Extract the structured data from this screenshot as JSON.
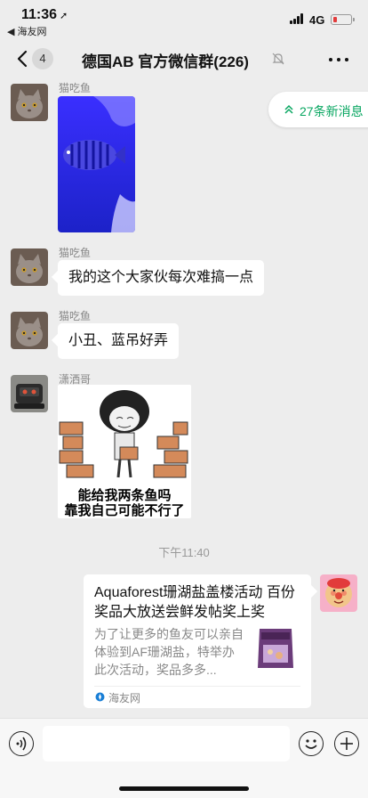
{
  "status_bar": {
    "time": "11:36",
    "location_arrow": "➚",
    "back_app": "◀ 海友网",
    "network": "4G"
  },
  "nav": {
    "unread_count": "4",
    "title": "德国AB  官方微信群(226)"
  },
  "new_messages": {
    "label": "27条新消息"
  },
  "messages": [
    {
      "sender": "猫吃鱼",
      "type": "image",
      "image": "blue-fish-photo"
    },
    {
      "sender": "猫吃鱼",
      "type": "text",
      "text": "我的这个大家伙每次难搞一点"
    },
    {
      "sender": "猫吃鱼",
      "type": "text",
      "text": "小丑、蓝吊好弄"
    },
    {
      "sender": "潇洒哥",
      "type": "sticker",
      "caption_line1": "能给我两条鱼吗",
      "caption_line2": "靠我自己可能不行了"
    }
  ],
  "timestamp": "下午11:40",
  "link_card": {
    "title": "Aquaforest珊湖盐盖楼活动 百份奖品大放送尝鲜发帖奖上奖",
    "description": "为了让更多的鱼友可以亲自体验到AF珊湖盐，特举办此次活动，奖品多多...",
    "source": "海友网"
  },
  "colors": {
    "background": "#ededed",
    "accent_green": "#07a660",
    "bubble": "#ffffff"
  }
}
